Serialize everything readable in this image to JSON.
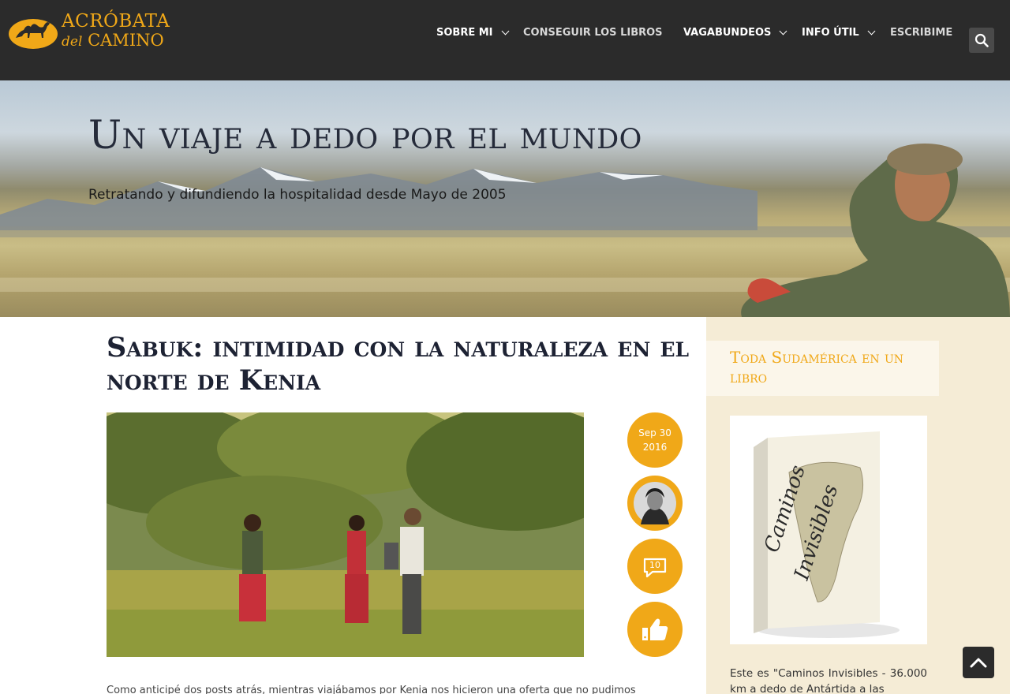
{
  "site": {
    "logo_line1": "ACRÓBATA",
    "logo_line2_small": "del",
    "logo_line2": "CAMINO"
  },
  "nav": {
    "items": [
      {
        "label": "SOBRE MI",
        "has_dropdown": true
      },
      {
        "label": "CONSEGUIR LOS LIBROS",
        "has_dropdown": false
      },
      {
        "label": "VAGABUNDEOS",
        "has_dropdown": true
      },
      {
        "label": "INFO ÚTIL",
        "has_dropdown": true
      },
      {
        "label": "ESCRIBIME",
        "has_dropdown": false
      }
    ],
    "search_icon": "search-icon"
  },
  "hero": {
    "title": "Un viaje a dedo por el mundo",
    "subtitle": "Retratando y difundiendo la hospitalidad desde Mayo de 2005"
  },
  "post": {
    "title": "Sabuk: intimidad con la naturaleza en el norte de Kenia",
    "date_day": "Sep 30",
    "date_year": "2016",
    "comments": "10",
    "excerpt": "Como anticipé dos posts atrás, mientras viajábamos por Kenia nos hicieron una oferta que no pudimos"
  },
  "sidebar": {
    "widget_title": "Toda Sudamérica en un libro",
    "book_title_1": "Caminos",
    "book_title_2": "Invisibles",
    "description": "Este es \"Caminos Invisibles - 36.000 km a dedo de Antártida a las"
  },
  "colors": {
    "accent": "#f0a818",
    "header_bg": "#2b2b2b",
    "sidebar_bg": "#f5ecd6"
  }
}
